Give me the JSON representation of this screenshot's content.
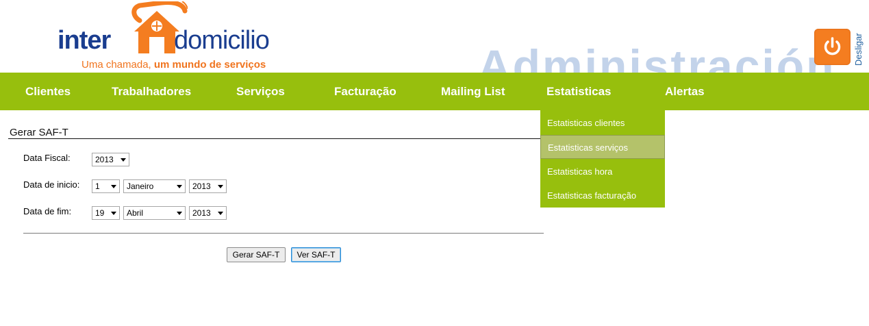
{
  "header": {
    "logo": {
      "part1": "inter",
      "part2": "domicilio",
      "tagline_regular": "Uma chamada, ",
      "tagline_bold": "um mundo de serviços"
    },
    "watermark": "Administración",
    "logout_label": "Desligar",
    "logout_icon": "power-icon"
  },
  "colors": {
    "nav_green": "#97bf0d",
    "brand_orange": "#f47d20",
    "brand_blue": "#1a3d8f"
  },
  "nav": {
    "items": [
      "Clientes",
      "Trabalhadores",
      "Serviços",
      "Facturação",
      "Mailing List",
      "Estatisticas",
      "Alertas"
    ],
    "active": "Estatisticas"
  },
  "dropdown": {
    "items": [
      "Estatisticas clientes",
      "Estatisticas serviços",
      "Estatisticas hora",
      "Estatisticas facturação"
    ],
    "highlighted": "Estatisticas serviços"
  },
  "form": {
    "title": "Gerar SAF-T",
    "fiscal_label": "Data Fiscal:",
    "fiscal_year": "2013",
    "start_label": "Data de inicio:",
    "start_day": "1",
    "start_month": "Janeiro",
    "start_year": "2013",
    "end_label": "Data de fim:",
    "end_day": "19",
    "end_month": "Abril",
    "end_year": "2013",
    "generate_button": "Gerar SAF-T",
    "view_button": "Ver SAF-T"
  }
}
